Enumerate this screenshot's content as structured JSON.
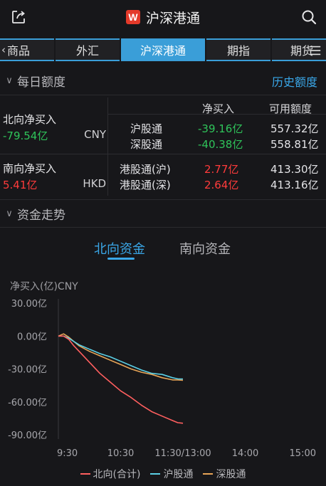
{
  "header": {
    "title": "沪深港通",
    "logo_letter": "W",
    "logo_color": "#e43a2a",
    "share_icon": "share-icon",
    "search_icon": "search-icon"
  },
  "tabs": [
    {
      "label": "商品",
      "active": false
    },
    {
      "label": "外汇",
      "active": false
    },
    {
      "label": "沪深港通",
      "active": true
    },
    {
      "label": "期指",
      "active": false
    },
    {
      "label": "期货",
      "active": false
    }
  ],
  "tabs_nav": {
    "prev_icon": "chevron-left-icon",
    "menu_icon": "menu-icon"
  },
  "daily_quota": {
    "title": "每日额度",
    "history_link": "历史额度",
    "columns": {
      "net_buy": "净买入",
      "available": "可用额度"
    },
    "northbound": {
      "label": "北向净买入",
      "value": "-79.54亿",
      "currency": "CNY",
      "rows": [
        {
          "name": "沪股通",
          "net_buy": "-39.16亿",
          "available": "557.32亿"
        },
        {
          "name": "深股通",
          "net_buy": "-40.38亿",
          "available": "558.81亿"
        }
      ]
    },
    "southbound": {
      "label": "南向净买入",
      "value": "5.41亿",
      "currency": "HKD",
      "rows": [
        {
          "name": "港股通(沪)",
          "net_buy": "2.77亿",
          "available": "413.30亿"
        },
        {
          "name": "港股通(深)",
          "net_buy": "2.64亿",
          "available": "413.16亿"
        }
      ]
    }
  },
  "capital_trend": {
    "title": "资金走势",
    "subtabs": [
      {
        "label": "北向资金",
        "active": true
      },
      {
        "label": "南向资金",
        "active": false
      }
    ]
  },
  "colors": {
    "accent": "#3aa7e8",
    "up": "#ff3b3b",
    "down": "#2fc45a",
    "north_line": "#ff5f5f",
    "sh_line": "#5bd0e6",
    "sz_line": "#e8a557"
  },
  "chart_data": {
    "type": "line",
    "ylabel": "净买入(亿)CNY",
    "ylim": [
      -90,
      30
    ],
    "yticks": [
      "30.00亿",
      "0.00亿",
      "-30.00亿",
      "-60.00亿",
      "-90.00亿"
    ],
    "yticks_values": [
      30,
      0,
      -30,
      -60,
      -90
    ],
    "xticks": [
      "9:30",
      "10:30",
      "11:30/13:00",
      "14:00",
      "15:00"
    ],
    "xticks_minutes": [
      0,
      60,
      120,
      180,
      240
    ],
    "x_minutes": [
      0,
      5,
      10,
      15,
      20,
      30,
      40,
      50,
      60,
      70,
      80,
      90,
      100,
      110,
      115,
      120
    ],
    "series": [
      {
        "name": "北向(合计)",
        "color": "#ff5f5f",
        "values": [
          0,
          0,
          -3,
          -9,
          -14,
          -24,
          -34,
          -42,
          -50,
          -56,
          -63,
          -69,
          -73,
          -77,
          -79,
          -79.5
        ]
      },
      {
        "name": "沪股通",
        "color": "#5bd0e6",
        "values": [
          0,
          0,
          -2,
          -5,
          -8,
          -12,
          -16,
          -19,
          -23,
          -27,
          -31,
          -34,
          -35,
          -38,
          -39,
          -39.2
        ]
      },
      {
        "name": "深股通",
        "color": "#e8a557",
        "values": [
          0,
          2,
          -1,
          -5,
          -9,
          -14,
          -18,
          -22,
          -26,
          -30,
          -33,
          -35,
          -38,
          -40,
          -40,
          -40.4
        ]
      }
    ],
    "grid": false,
    "legend_position": "bottom"
  }
}
